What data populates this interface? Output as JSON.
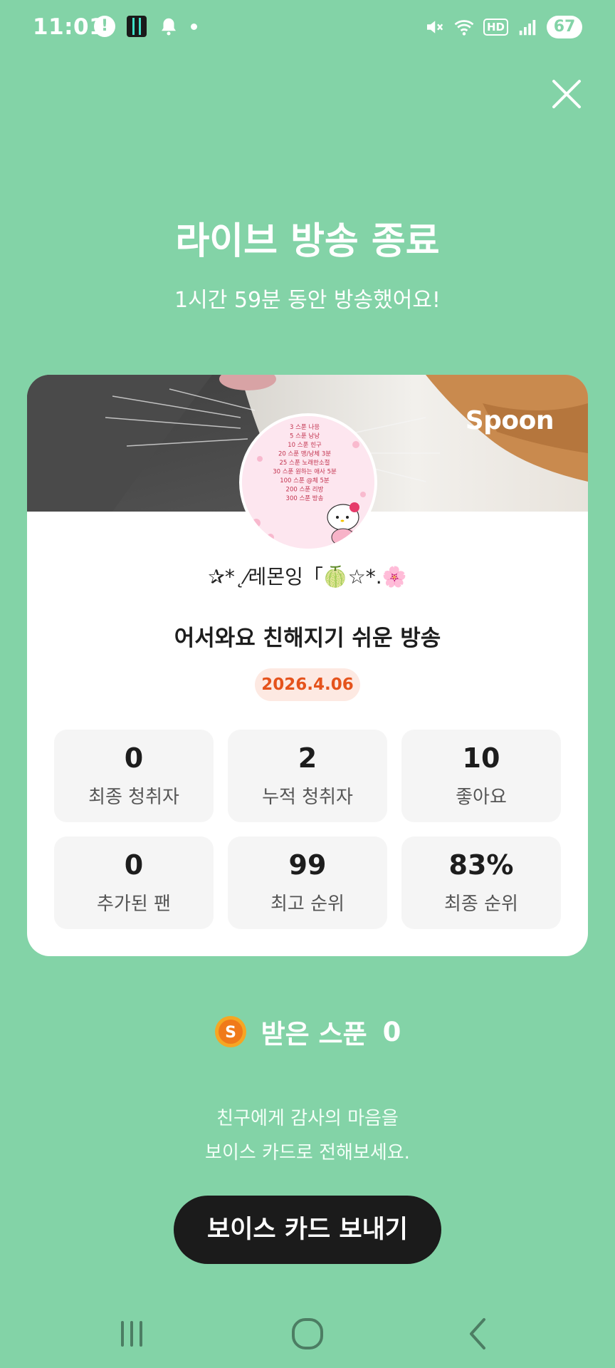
{
  "status_bar": {
    "time": "11:01",
    "hd_label": "HD",
    "battery": "67",
    "icons": [
      "alert-icon",
      "app-icon",
      "bell-icon",
      "dot-icon",
      "mute-icon",
      "wifi-icon",
      "hd-icon",
      "signal-icon",
      "battery-icon"
    ]
  },
  "header": {
    "close_icon": "close-icon",
    "title": "라이브 방송 종료",
    "subtitle": "1시간 59분 동안 방송했어요!"
  },
  "card": {
    "brand": "Spoon",
    "avatar_lines": [
      "3 스푼 나응",
      "5 스푼 낭낭",
      "10 스푼 힌구",
      "20 스푼 맹/낭체 3분",
      "25 스푼 노래한소절",
      "30 스푼 원하는 애사 5분",
      "100 스푼 @체 5분",
      "200 스푼 리방",
      "300 스푼 방송"
    ],
    "nickname": "✰*˛⁄레몬잉「🍈☆*.🌸",
    "room_title": "어서와요 친해지기 쉬운 방송",
    "date": "2026.4.06",
    "stats": [
      {
        "value": "0",
        "label": "최종 청취자"
      },
      {
        "value": "2",
        "label": "누적 청취자"
      },
      {
        "value": "10",
        "label": "좋아요"
      },
      {
        "value": "0",
        "label": "추가된 팬"
      },
      {
        "value": "99",
        "label": "최고 순위"
      },
      {
        "value": "83%",
        "label": "최종 순위"
      }
    ]
  },
  "spoons": {
    "coin_letter": "S",
    "label": "받은 스푼",
    "count": "0"
  },
  "message": {
    "line1": "친구에게 감사의 마음을",
    "line2": "보이스 카드로 전해보세요."
  },
  "voice_card_button": "보이스 카드 보내기",
  "navbar": {
    "icons": [
      "recents-icon",
      "home-icon",
      "back-icon"
    ]
  },
  "colors": {
    "background": "#83d3a7",
    "date_badge_bg": "#fde9e2",
    "date_badge_text": "#e5531c",
    "button_bg": "#1b1b1b"
  }
}
